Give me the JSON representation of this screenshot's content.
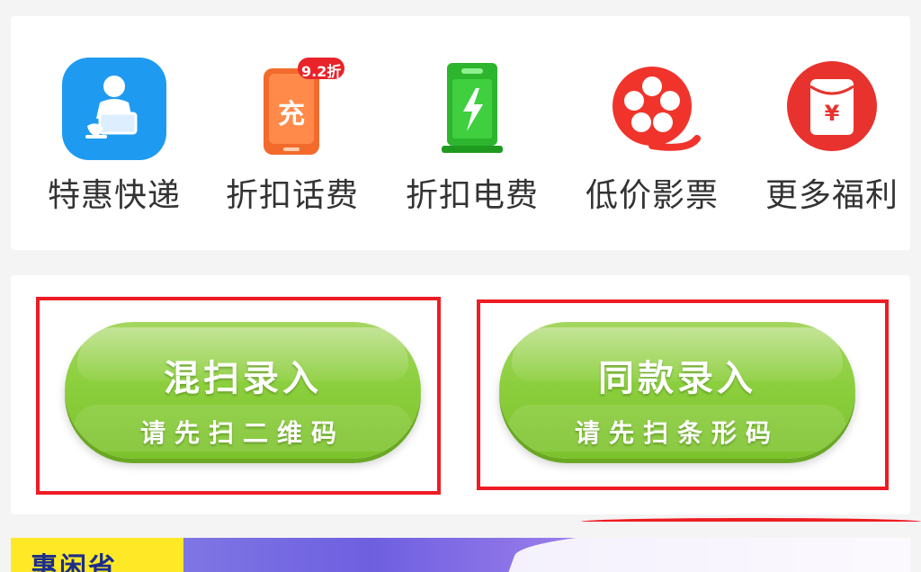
{
  "services": [
    {
      "label": "特惠快递",
      "icon": "courier-icon"
    },
    {
      "label": "折扣话费",
      "icon": "phone-recharge-icon",
      "badge": "9.2折",
      "icon_text": "充"
    },
    {
      "label": "折扣电费",
      "icon": "electricity-icon"
    },
    {
      "label": "低价影票",
      "icon": "film-reel-icon"
    },
    {
      "label": "更多福利",
      "icon": "red-envelope-icon",
      "icon_text": "¥"
    }
  ],
  "scan_buttons": {
    "mixed": {
      "title": "混扫录入",
      "subtitle": "请先扫二维码"
    },
    "same": {
      "title": "同款录入",
      "subtitle": "请先扫条形码"
    }
  },
  "banner": {
    "tag": "惠闲省"
  },
  "colors": {
    "accent_green": "#8ccf3e",
    "highlight_red": "#ee1c24",
    "courier_blue": "#1e9bf0",
    "recharge_orange": "#f26b2c",
    "electric_green": "#2db52d",
    "film_red": "#f0342c",
    "envelope_red": "#e8322e"
  }
}
